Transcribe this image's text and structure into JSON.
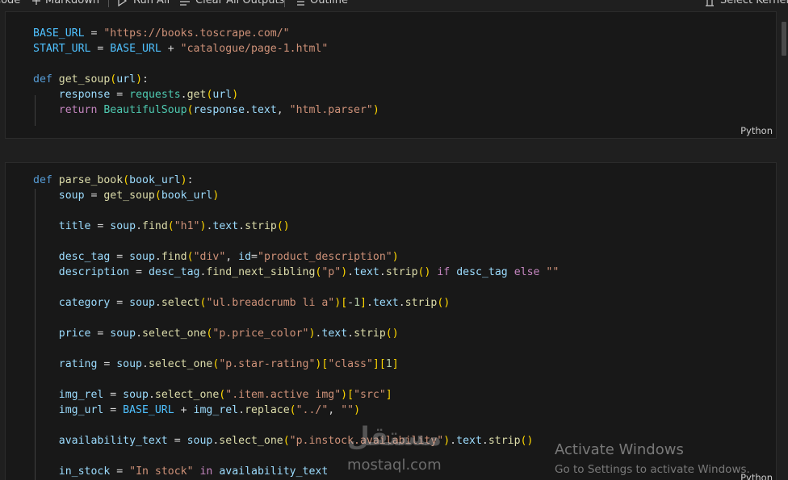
{
  "toolbar": {
    "code_label": "Code",
    "markdown_label": "Markdown",
    "run_all_label": "Run All",
    "clear_outputs_label": "Clear All Outputs",
    "outline_label": "Outline",
    "more_label": "···",
    "kernel_label": "Select Kernel"
  },
  "cell1": {
    "language": "Python",
    "lines": [
      [
        [
          "cn",
          "BASE_URL"
        ],
        [
          "op",
          " = "
        ],
        [
          "st",
          "\"https://books.toscrape.com/\""
        ]
      ],
      [
        [
          "cn",
          "START_URL"
        ],
        [
          "op",
          " = "
        ],
        [
          "cn",
          "BASE_URL"
        ],
        [
          "op",
          " + "
        ],
        [
          "st",
          "\"catalogue/page-1.html\""
        ]
      ],
      [],
      [
        [
          "k1",
          "def "
        ],
        [
          "fn",
          "get_soup"
        ],
        [
          "b1",
          "("
        ],
        [
          "vr",
          "url"
        ],
        [
          "b1",
          ")"
        ],
        [
          "op",
          ":"
        ]
      ],
      [
        [
          "op",
          "    "
        ],
        [
          "vr",
          "response"
        ],
        [
          "op",
          " = "
        ],
        [
          "cl",
          "requests"
        ],
        [
          "op",
          "."
        ],
        [
          "fn",
          "get"
        ],
        [
          "b1",
          "("
        ],
        [
          "vr",
          "url"
        ],
        [
          "b1",
          ")"
        ]
      ],
      [
        [
          "op",
          "    "
        ],
        [
          "k2",
          "return "
        ],
        [
          "cl",
          "BeautifulSoup"
        ],
        [
          "b1",
          "("
        ],
        [
          "vr",
          "response"
        ],
        [
          "op",
          "."
        ],
        [
          "vr",
          "text"
        ],
        [
          "op",
          ", "
        ],
        [
          "st",
          "\"html.parser\""
        ],
        [
          "b1",
          ")"
        ]
      ]
    ]
  },
  "cell2": {
    "language": "Python",
    "lines": [
      [
        [
          "k1",
          "def "
        ],
        [
          "fn",
          "parse_book"
        ],
        [
          "b1",
          "("
        ],
        [
          "vr",
          "book_url"
        ],
        [
          "b1",
          ")"
        ],
        [
          "op",
          ":"
        ]
      ],
      [
        [
          "op",
          "    "
        ],
        [
          "vr",
          "soup"
        ],
        [
          "op",
          " = "
        ],
        [
          "fn",
          "get_soup"
        ],
        [
          "b1",
          "("
        ],
        [
          "vr",
          "book_url"
        ],
        [
          "b1",
          ")"
        ]
      ],
      [],
      [
        [
          "op",
          "    "
        ],
        [
          "vr",
          "title"
        ],
        [
          "op",
          " = "
        ],
        [
          "vr",
          "soup"
        ],
        [
          "op",
          "."
        ],
        [
          "fn",
          "find"
        ],
        [
          "b1",
          "("
        ],
        [
          "st",
          "\"h1\""
        ],
        [
          "b1",
          ")"
        ],
        [
          "op",
          "."
        ],
        [
          "vr",
          "text"
        ],
        [
          "op",
          "."
        ],
        [
          "fn",
          "strip"
        ],
        [
          "b1",
          "()"
        ]
      ],
      [],
      [
        [
          "op",
          "    "
        ],
        [
          "vr",
          "desc_tag"
        ],
        [
          "op",
          " = "
        ],
        [
          "vr",
          "soup"
        ],
        [
          "op",
          "."
        ],
        [
          "fn",
          "find"
        ],
        [
          "b1",
          "("
        ],
        [
          "st",
          "\"div\""
        ],
        [
          "op",
          ", "
        ],
        [
          "vr",
          "id"
        ],
        [
          "op",
          "="
        ],
        [
          "st",
          "\"product_description\""
        ],
        [
          "b1",
          ")"
        ]
      ],
      [
        [
          "op",
          "    "
        ],
        [
          "vr",
          "description"
        ],
        [
          "op",
          " = "
        ],
        [
          "vr",
          "desc_tag"
        ],
        [
          "op",
          "."
        ],
        [
          "fn",
          "find_next_sibling"
        ],
        [
          "b1",
          "("
        ],
        [
          "st",
          "\"p\""
        ],
        [
          "b1",
          ")"
        ],
        [
          "op",
          "."
        ],
        [
          "vr",
          "text"
        ],
        [
          "op",
          "."
        ],
        [
          "fn",
          "strip"
        ],
        [
          "b1",
          "()"
        ],
        [
          "op",
          " "
        ],
        [
          "k2",
          "if"
        ],
        [
          "op",
          " "
        ],
        [
          "vr",
          "desc_tag"
        ],
        [
          "op",
          " "
        ],
        [
          "k2",
          "else"
        ],
        [
          "op",
          " "
        ],
        [
          "st",
          "\"\""
        ]
      ],
      [],
      [
        [
          "op",
          "    "
        ],
        [
          "vr",
          "category"
        ],
        [
          "op",
          " = "
        ],
        [
          "vr",
          "soup"
        ],
        [
          "op",
          "."
        ],
        [
          "fn",
          "select"
        ],
        [
          "b1",
          "("
        ],
        [
          "st",
          "\"ul.breadcrumb li a\""
        ],
        [
          "b1",
          ")"
        ],
        [
          "b1",
          "["
        ],
        [
          "op",
          "-"
        ],
        [
          "nm",
          "1"
        ],
        [
          "b1",
          "]"
        ],
        [
          "op",
          "."
        ],
        [
          "vr",
          "text"
        ],
        [
          "op",
          "."
        ],
        [
          "fn",
          "strip"
        ],
        [
          "b1",
          "()"
        ]
      ],
      [],
      [
        [
          "op",
          "    "
        ],
        [
          "vr",
          "price"
        ],
        [
          "op",
          " = "
        ],
        [
          "vr",
          "soup"
        ],
        [
          "op",
          "."
        ],
        [
          "fn",
          "select_one"
        ],
        [
          "b1",
          "("
        ],
        [
          "st",
          "\"p.price_color\""
        ],
        [
          "b1",
          ")"
        ],
        [
          "op",
          "."
        ],
        [
          "vr",
          "text"
        ],
        [
          "op",
          "."
        ],
        [
          "fn",
          "strip"
        ],
        [
          "b1",
          "()"
        ]
      ],
      [],
      [
        [
          "op",
          "    "
        ],
        [
          "vr",
          "rating"
        ],
        [
          "op",
          " = "
        ],
        [
          "vr",
          "soup"
        ],
        [
          "op",
          "."
        ],
        [
          "fn",
          "select_one"
        ],
        [
          "b1",
          "("
        ],
        [
          "st",
          "\"p.star-rating\""
        ],
        [
          "b1",
          ")"
        ],
        [
          "b1",
          "["
        ],
        [
          "st",
          "\"class\""
        ],
        [
          "b1",
          "]"
        ],
        [
          "b1",
          "["
        ],
        [
          "nm",
          "1"
        ],
        [
          "b1",
          "]"
        ]
      ],
      [],
      [
        [
          "op",
          "    "
        ],
        [
          "vr",
          "img_rel"
        ],
        [
          "op",
          " = "
        ],
        [
          "vr",
          "soup"
        ],
        [
          "op",
          "."
        ],
        [
          "fn",
          "select_one"
        ],
        [
          "b1",
          "("
        ],
        [
          "st",
          "\".item.active img\""
        ],
        [
          "b1",
          ")"
        ],
        [
          "b1",
          "["
        ],
        [
          "st",
          "\"src\""
        ],
        [
          "b1",
          "]"
        ]
      ],
      [
        [
          "op",
          "    "
        ],
        [
          "vr",
          "img_url"
        ],
        [
          "op",
          " = "
        ],
        [
          "cn",
          "BASE_URL"
        ],
        [
          "op",
          " + "
        ],
        [
          "vr",
          "img_rel"
        ],
        [
          "op",
          "."
        ],
        [
          "fn",
          "replace"
        ],
        [
          "b1",
          "("
        ],
        [
          "st",
          "\"../\""
        ],
        [
          "op",
          ", "
        ],
        [
          "st",
          "\"\""
        ],
        [
          "b1",
          ")"
        ]
      ],
      [],
      [
        [
          "op",
          "    "
        ],
        [
          "vr",
          "availability_text"
        ],
        [
          "op",
          " = "
        ],
        [
          "vr",
          "soup"
        ],
        [
          "op",
          "."
        ],
        [
          "fn",
          "select_one"
        ],
        [
          "b1",
          "("
        ],
        [
          "st",
          "\"p.instock.availability\""
        ],
        [
          "b1",
          ")"
        ],
        [
          "op",
          "."
        ],
        [
          "vr",
          "text"
        ],
        [
          "op",
          "."
        ],
        [
          "fn",
          "strip"
        ],
        [
          "b1",
          "()"
        ]
      ],
      [],
      [
        [
          "op",
          "    "
        ],
        [
          "vr",
          "in_stock"
        ],
        [
          "op",
          " = "
        ],
        [
          "st",
          "\"In stock\""
        ],
        [
          "op",
          " "
        ],
        [
          "k2",
          "in"
        ],
        [
          "op",
          " "
        ],
        [
          "vr",
          "availability_text"
        ]
      ]
    ]
  },
  "watermark": {
    "logo": "مستقل",
    "text": "mostaql.com"
  },
  "activate": {
    "title": "Activate Windows",
    "subtitle": "Go to Settings to activate Windows."
  }
}
